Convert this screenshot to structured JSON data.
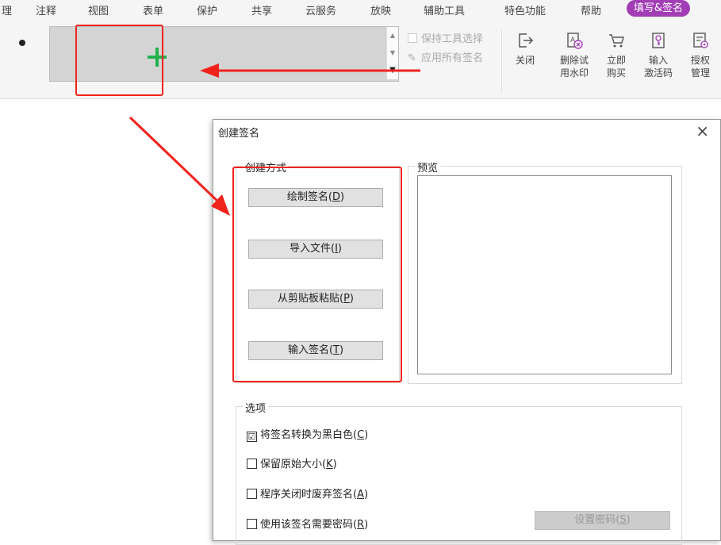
{
  "menu": {
    "items": [
      "理",
      "注释",
      "视图",
      "表单",
      "保护",
      "共享",
      "云服务",
      "放映",
      "辅助工具",
      "特色功能",
      "帮助"
    ],
    "active": "填写&签名"
  },
  "ribbon": {
    "keep_tool_label": "保持工具选择",
    "apply_all_label": "应用所有签名",
    "tools": {
      "close": {
        "line1": "关闭",
        "line2": ""
      },
      "remove_watermark": {
        "line1": "删除试",
        "line2": "用水印"
      },
      "buy": {
        "line1": "立即",
        "line2": "购买"
      },
      "activate": {
        "line1": "输入",
        "line2": "激活码"
      },
      "license": {
        "line1": "授权",
        "line2": "管理"
      }
    }
  },
  "dialog": {
    "title": "创建签名",
    "close": "×",
    "create_group": "创建方式",
    "preview_group": "预览",
    "buttons": {
      "draw": {
        "label": "绘制签名(",
        "key": "D",
        "end": ")"
      },
      "import": {
        "label": "导入文件(",
        "key": "I",
        "end": ")"
      },
      "paste": {
        "label": "从剪贴板粘贴(",
        "key": "P",
        "end": ")"
      },
      "type": {
        "label": "输入签名(",
        "key": "T",
        "end": ")"
      }
    },
    "options_group": "选项",
    "options": [
      {
        "label": "将签名转换为黑白色(",
        "key": "C",
        "end": ")",
        "checked": "☑"
      },
      {
        "label": "保留原始大小(",
        "key": "K",
        "end": ")",
        "checked": ""
      },
      {
        "label": "程序关闭时废弃签名(",
        "key": "A",
        "end": ")",
        "checked": ""
      },
      {
        "label": "使用该签名需要密码(",
        "key": "R",
        "end": ")",
        "checked": ""
      }
    ],
    "set_password": {
      "label": "设置密码(",
      "key": "S",
      "end": ")"
    }
  },
  "colors": {
    "accent": "#a23db6",
    "annotation": "#f0231c",
    "plus": "#22b14c"
  }
}
